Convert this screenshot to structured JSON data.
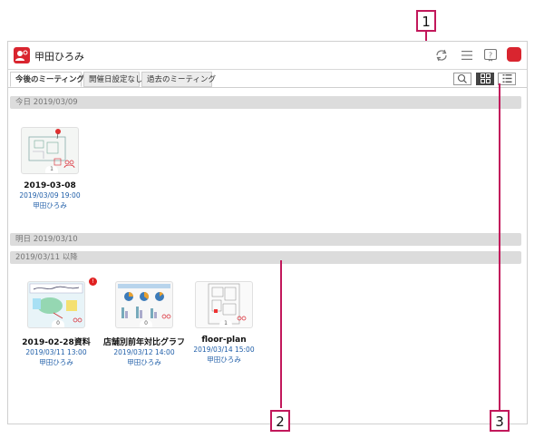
{
  "app": {
    "title": "甲田ひろみ"
  },
  "tabs": [
    {
      "label": "今後のミーティング",
      "active": true
    },
    {
      "label": "開催日設定なし",
      "active": false
    },
    {
      "label": "過去のミーティング",
      "active": false
    }
  ],
  "sections": [
    {
      "label": "今日 2019/03/09"
    },
    {
      "label": "明日 2019/03/10"
    },
    {
      "label": "2019/03/11 以降"
    }
  ],
  "meetings_today": [
    {
      "title": "2019-03-08",
      "datetime": "2019/03/09 19:00",
      "owner": "甲田ひろみ",
      "count": "1"
    }
  ],
  "meetings_later": [
    {
      "title": "2019-02-28資料",
      "datetime": "2019/03/11 13:00",
      "owner": "甲田ひろみ",
      "count": "0"
    },
    {
      "title": "店舗別前年対比グラフ",
      "datetime": "2019/03/12 14:00",
      "owner": "甲田ひろみ",
      "count": "0"
    },
    {
      "title": "floor-plan",
      "datetime": "2019/03/14 15:00",
      "owner": "甲田ひろみ",
      "count": "1"
    }
  ],
  "callouts": [
    "1",
    "2",
    "3"
  ],
  "colors": {
    "accent": "#c2185b",
    "brand": "#d9252f",
    "link": "#1f5ea8"
  },
  "icons": {
    "sync": "sync-icon",
    "menu": "menu-icon",
    "help": "help-icon",
    "search": "search-icon",
    "grid": "grid-view-icon",
    "list": "list-view-icon"
  }
}
